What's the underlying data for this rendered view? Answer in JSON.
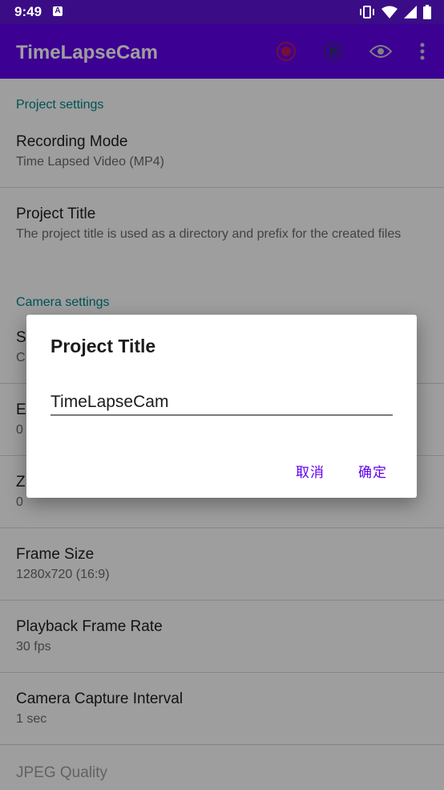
{
  "status_bar": {
    "time": "9:49",
    "notification_icon": "A",
    "icons": [
      "vibrate-icon",
      "wifi-icon",
      "signal-icon",
      "battery-icon"
    ]
  },
  "app_bar": {
    "title": "TimeLapseCam",
    "actions": [
      "record-icon",
      "stop-icon",
      "eye-icon",
      "more-vert-icon"
    ]
  },
  "preferences": {
    "project_settings": {
      "header": "Project settings",
      "recording_mode": {
        "title": "Recording Mode",
        "summary": "Time Lapsed Video (MP4)"
      },
      "project_title": {
        "title": "Project Title",
        "summary": "The project title is used as a directory and prefix for the created files"
      }
    },
    "camera_settings": {
      "header": "Camera settings",
      "partial_1": {
        "title": "S",
        "summary": "C"
      },
      "partial_2": {
        "title": "E",
        "summary": "0"
      },
      "partial_3": {
        "title": "Z",
        "summary": "0"
      },
      "frame_size": {
        "title": "Frame Size",
        "summary": "1280x720 (16:9)"
      },
      "playback_frame_rate": {
        "title": "Playback Frame Rate",
        "summary": "30 fps"
      },
      "capture_interval": {
        "title": "Camera Capture Interval",
        "summary": "1 sec"
      },
      "jpeg_quality": {
        "title": "JPEG Quality"
      }
    }
  },
  "dialog": {
    "title": "Project Title",
    "input_value": "TimeLapseCam",
    "cancel_label": "取消",
    "ok_label": "确定"
  },
  "colors": {
    "status_bar": "#3a0d87",
    "app_bar": "#6200ee",
    "accent": "#6200ee",
    "category": "#018786"
  }
}
